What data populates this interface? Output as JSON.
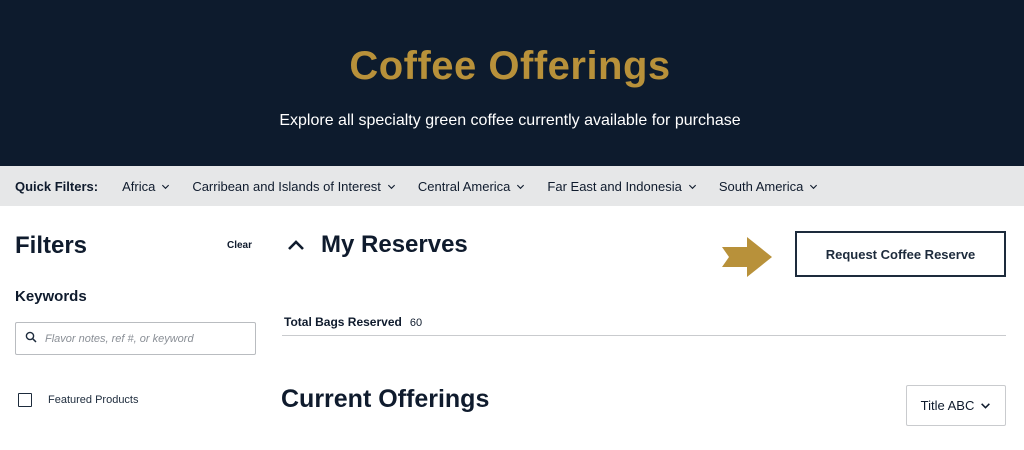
{
  "hero": {
    "title": "Coffee Offerings",
    "subtitle": "Explore all specialty green coffee currently available for purchase"
  },
  "quick_filters": {
    "label": "Quick Filters:",
    "items": [
      {
        "label": "Africa",
        "icon": "chevron-down-icon"
      },
      {
        "label": "Carribean and Islands of Interest",
        "icon": "chevron-down-icon"
      },
      {
        "label": "Central America",
        "icon": "chevron-down-icon"
      },
      {
        "label": "Far East and Indonesia",
        "icon": "chevron-down-icon"
      },
      {
        "label": "South America",
        "icon": "chevron-down-icon"
      }
    ]
  },
  "sidebar": {
    "title": "Filters",
    "clear_label": "Clear",
    "keywords_label": "Keywords",
    "search": {
      "placeholder": "Flavor notes, ref #, or keyword",
      "value": "",
      "icon": "search-icon"
    },
    "featured_label": "Featured Products",
    "featured_checked": false
  },
  "reserves": {
    "title": "My Reserves",
    "icon": "chevron-up-icon",
    "request_button": "Request Coffee Reserve",
    "arrow_icon": "arrow-right-icon",
    "total_label": "Total Bags Reserved",
    "total_value": "60"
  },
  "offerings": {
    "title": "Current Offerings",
    "sort_label": "Title ABC"
  },
  "colors": {
    "navy": "#0d1b2d",
    "gold": "#b8913a",
    "gray_bar": "#e6e7e8"
  }
}
